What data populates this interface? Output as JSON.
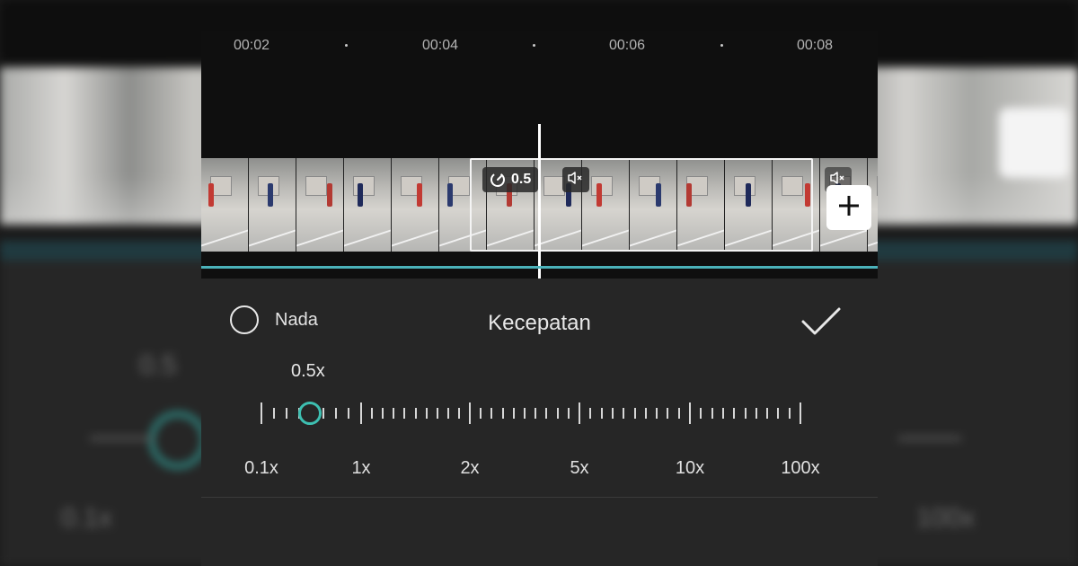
{
  "timeline": {
    "time_labels": [
      "00:02",
      "00:04",
      "00:06",
      "00:08"
    ]
  },
  "clip": {
    "speed_badge": "0.5"
  },
  "speed_panel": {
    "current_value": "0.5x",
    "current_value_numeric": 0.5,
    "scale_labels": [
      "0.1x",
      "1x",
      "2x",
      "5x",
      "10x",
      "100x"
    ],
    "knob_color": "#3dbfb1"
  },
  "footer": {
    "nada_label": "Nada",
    "title": "Kecepatan"
  },
  "icons": {
    "speed": "speed-dial-icon",
    "mute": "muted-speaker-icon",
    "add": "plus-icon",
    "confirm": "check-icon"
  },
  "colors": {
    "accent": "#3dbfb1",
    "audio_track": "#4bb2ba",
    "panel_bg": "#262626",
    "timeline_bg": "#0f0f0f"
  }
}
